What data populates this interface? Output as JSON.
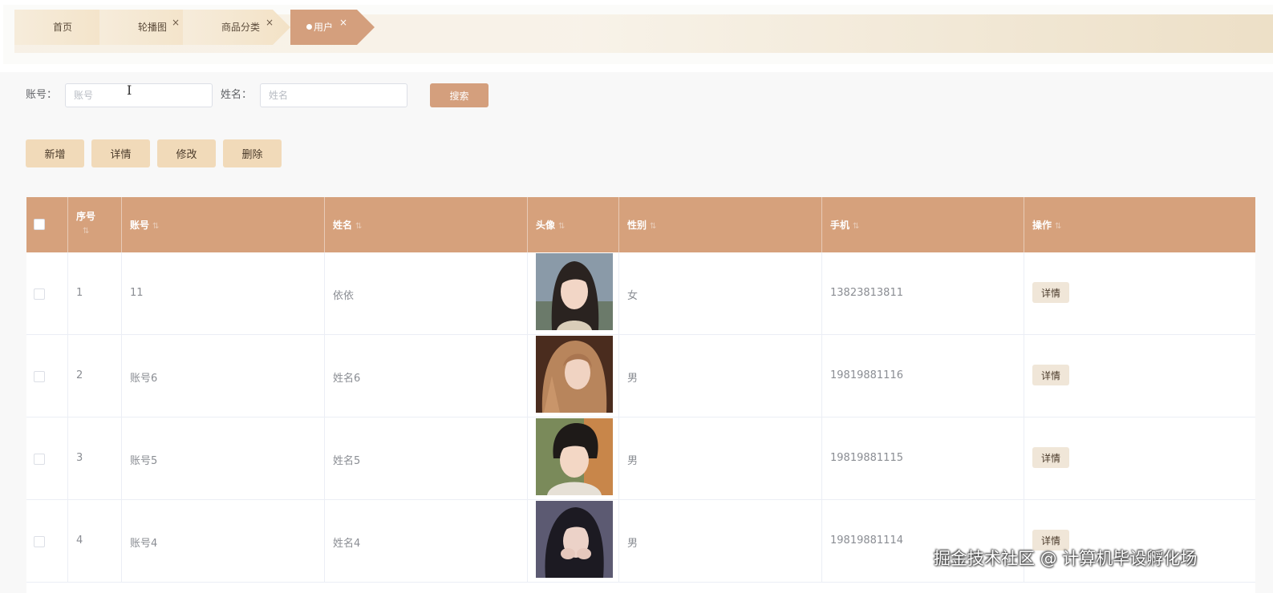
{
  "tabs": [
    {
      "label": "首页",
      "closable": false,
      "active": false
    },
    {
      "label": "轮播图",
      "closable": true,
      "active": false
    },
    {
      "label": "商品分类",
      "closable": true,
      "active": false
    },
    {
      "label": "用户",
      "closable": true,
      "active": true
    }
  ],
  "tab_close_glyph": "×",
  "search": {
    "account_label": "账号：",
    "account_placeholder": "账号",
    "account_value": "",
    "name_label": "姓名：",
    "name_placeholder": "姓名",
    "name_value": "",
    "button_label": "搜索"
  },
  "actions": {
    "add_label": "新增",
    "detail_label": "详情",
    "edit_label": "修改",
    "delete_label": "删除"
  },
  "table": {
    "columns": {
      "seq": "序号",
      "account": "账号",
      "name": "姓名",
      "avatar": "头像",
      "gender": "性别",
      "phone": "手机",
      "ops": "操作"
    },
    "sort_glyph": "⇅",
    "rows": [
      {
        "seq": "1",
        "account": "11",
        "name": "依依",
        "gender": "女",
        "phone": "13823813811",
        "op_label": "详情"
      },
      {
        "seq": "2",
        "account": "账号6",
        "name": "姓名6",
        "gender": "男",
        "phone": "19819881116",
        "op_label": "详情"
      },
      {
        "seq": "3",
        "account": "账号5",
        "name": "姓名5",
        "gender": "男",
        "phone": "19819881115",
        "op_label": "详情"
      },
      {
        "seq": "4",
        "account": "账号4",
        "name": "姓名4",
        "gender": "男",
        "phone": "19819881114",
        "op_label": "详情"
      }
    ]
  },
  "watermark": "掘金技术社区 @ 计算机毕设孵化场",
  "colors": {
    "accent": "#d49f7d",
    "header": "#d6a17c",
    "action_button": "#f1dab9",
    "detail_button": "#f0e6d8"
  }
}
